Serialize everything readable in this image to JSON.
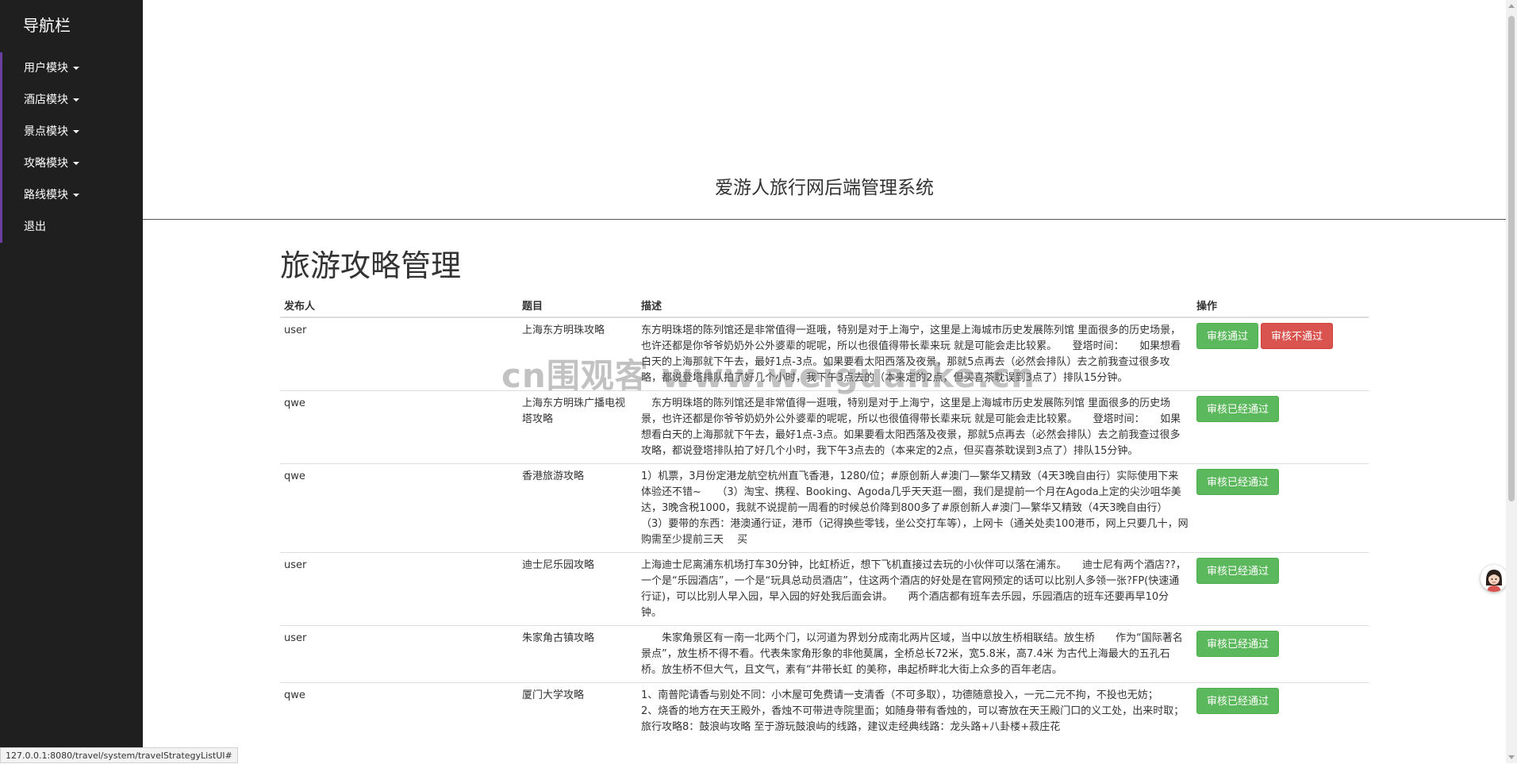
{
  "sidebar": {
    "title": "导航栏",
    "items": [
      {
        "label": "用户模块",
        "has_caret": true
      },
      {
        "label": "酒店模块",
        "has_caret": true
      },
      {
        "label": "景点模块",
        "has_caret": true
      },
      {
        "label": "攻略模块",
        "has_caret": true
      },
      {
        "label": "路线模块",
        "has_caret": true
      },
      {
        "label": "退出",
        "has_caret": false
      }
    ]
  },
  "header": {
    "title": "爱游人旅行网后端管理系统"
  },
  "main": {
    "heading": "旅游攻略管理",
    "table": {
      "columns": [
        "发布人",
        "题目",
        "描述",
        "操作"
      ],
      "rows": [
        {
          "author": "user",
          "title": "上海东方明珠攻略",
          "description": "东方明珠塔的陈列馆还是非常值得一逛哦，特别是对于上海宁，这里是上海城市历史发展陈列馆 里面很多的历史场景，也许还都是你爷爷奶奶外公外婆辈的呢呢，所以也很值得带长辈来玩 就是可能会走比较累。　　登塔时间：　　如果想看白天的上海那就下午去，最好1点-3点。如果要看太阳西落及夜景，那就5点再去（必然会排队）去之前我查过很多攻略，都说登塔排队拍了好几个小时，我下午3点去的（本来定的2点，但买喜茶耽误到3点了）排队15分钟。",
          "buttons": [
            "审核通过",
            "审核不通过"
          ]
        },
        {
          "author": "qwe",
          "title": "上海东方明珠广播电视塔攻略",
          "description": "　东方明珠塔的陈列馆还是非常值得一逛哦，特别是对于上海宁，这里是上海城市历史发展陈列馆 里面很多的历史场景，也许还都是你爷爷奶奶外公外婆辈的呢呢，所以也很值得带长辈来玩 就是可能会走比较累。　　登塔时间：　　如果想看白天的上海那就下午去，最好1点-3点。如果要看太阳西落及夜景，那就5点再去（必然会排队）去之前我查过很多攻略，都说登塔排队拍了好几个小时，我下午3点去的（本来定的2点，但买喜茶耽误到3点了）排队15分钟。",
          "buttons": [
            "审核已经通过"
          ]
        },
        {
          "author": "qwe",
          "title": "香港旅游攻略",
          "description": "1）机票，3月份定港龙航空杭州直飞香港，1280/位；#原创新人#澳门—繁华又精致（4天3晚自由行）实际使用下来体验还不错~　　（3）淘宝、携程、Booking、Agoda几乎天天逛一圈，我们是提前一个月在Agoda上定的尖沙咀华美达，3晚含税1000，我就不说提前一周看的时候总价降到800多了#原创新人#澳门—繁华又精致（4天3晚自由行）　　（3）要带的东西：港澳通行证，港币（记得换些零钱，坐公交打车等），上网卡（通关处卖100港币，网上只要几十，网购需至少提前三天　 买",
          "buttons": [
            "审核已经通过"
          ]
        },
        {
          "author": "user",
          "title": "迪士尼乐园攻略",
          "description": "上海迪士尼离浦东机场打车30分钟，比虹桥近，想下飞机直接过去玩的小伙伴可以落在浦东。　　迪士尼有两个酒店??，一个是“乐园酒店”，一个是“玩具总动员酒店”，住这两个酒店的好处是在官网预定的话可以比别人多领一张?FP(快速通行证)，可以比别人早入园，早入园的好处我后面会讲。　　两个酒店都有班车去乐园，乐园酒店的班车还要再早10分钟。",
          "buttons": [
            "审核已经通过"
          ]
        },
        {
          "author": "user",
          "title": "朱家角古镇攻略",
          "description": "　　朱家角景区有一南一北两个门，以河道为界划分成南北两片区域，当中以放生桥相联结。放生桥　　作为“国际著名景点”，放生桥不得不看。代表朱家角形象的非他莫属，全桥总长72米，宽5.8米，高7.4米 为古代上海最大的五孔石桥。放生桥不但大气，且文气，素有“井带长虹 的美称，串起桥畔北大街上众多的百年老店。",
          "buttons": [
            "审核已经通过"
          ]
        },
        {
          "author": "qwe",
          "title": "厦门大学攻略",
          "description": "1、南普陀请香与别处不同：小木屋可免费请一支清香（不可多取），功德随意投入，一元二元不拘，不投也无妨；　　2、烧香的地方在天王殿外，香烛不可带进寺院里面；如随身带有香烛的，可以寄放在天王殿门口的义工处，出来时取；旅行攻略8：鼓浪屿攻略 至于游玩鼓浪屿的线路，建议走经典线路：龙头路+八卦楼+菽庄花",
          "buttons": [
            "审核已经通过"
          ]
        }
      ]
    }
  },
  "status_bar": {
    "url": "127.0.0.1:8080/travel/system/travelStrategyListUI#"
  },
  "watermark": {
    "text": "cn围观客 www.weiguanke.cn"
  },
  "colors": {
    "sidebar_bg": "#1f1f1f",
    "success": "#5cb85c",
    "danger": "#d9534f"
  }
}
